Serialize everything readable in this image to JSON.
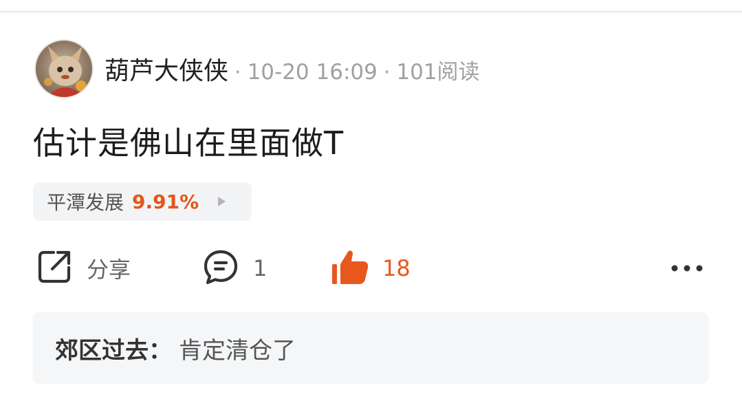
{
  "post": {
    "author": "葫芦大侠侠",
    "separator": "·",
    "time": "10-20 16:09",
    "reads": "101阅读",
    "content": "估计是佛山在里面做T"
  },
  "stock_tag": {
    "name": "平潭发展",
    "change": "9.91%",
    "change_color": "#e2561b",
    "icon": "play-arrow-icon"
  },
  "actions": {
    "share": {
      "label": "分享",
      "icon": "share-icon"
    },
    "comment": {
      "count": "1",
      "icon": "comment-icon"
    },
    "like": {
      "count": "18",
      "icon": "thumbs-up-icon",
      "color": "#e8581c"
    },
    "more": {
      "icon": "more-icon"
    }
  },
  "reply": {
    "author": "郊区过去",
    "colon": "：",
    "text": "肯定清仓了"
  }
}
